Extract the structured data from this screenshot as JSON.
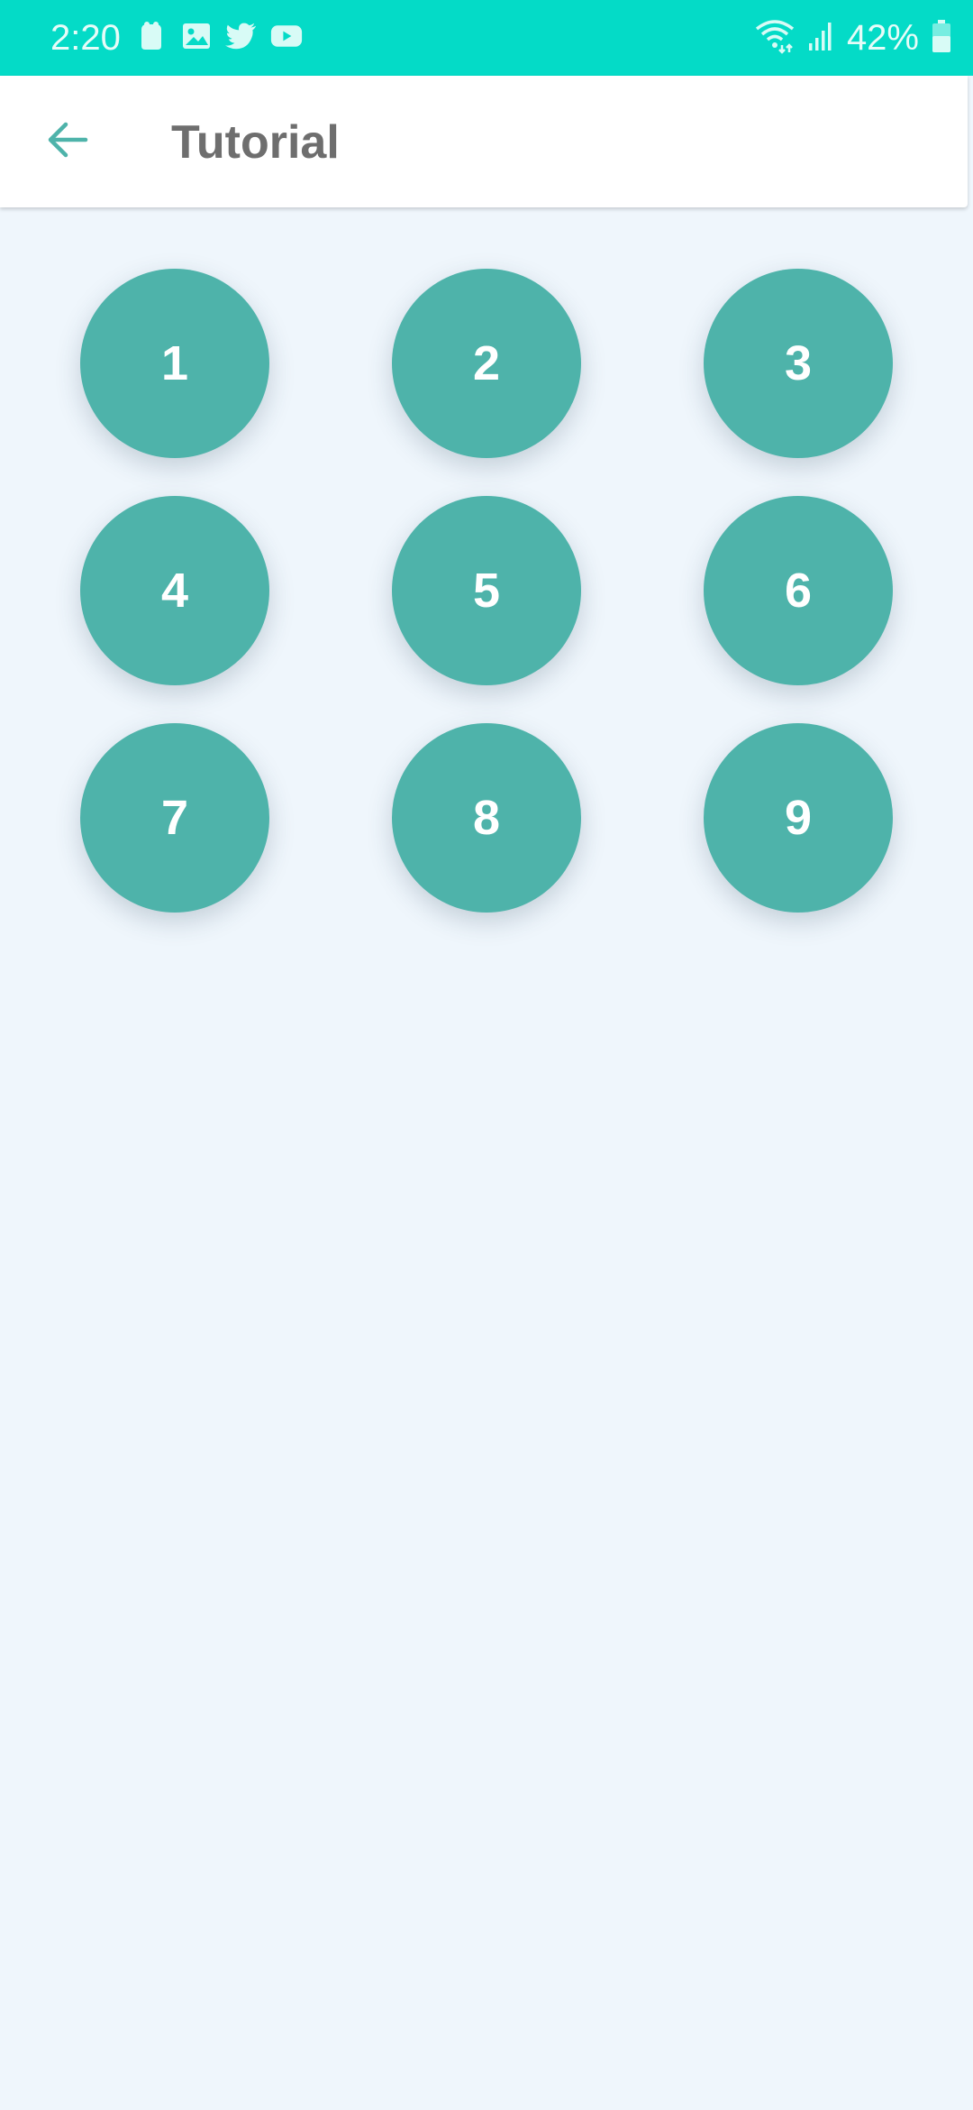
{
  "status_bar": {
    "time": "2:20",
    "battery": "42%",
    "color": "#04DBC7",
    "left_icons": [
      "notification-app-icon",
      "gallery-icon",
      "twitter-icon",
      "youtube-icon"
    ],
    "right_icons": [
      "wifi-icon",
      "signal-icon",
      "battery-icon"
    ]
  },
  "app_bar": {
    "title": "Tutorial",
    "back_icon": "arrow-left-icon"
  },
  "grid": {
    "items": [
      "1",
      "2",
      "3",
      "4",
      "5",
      "6",
      "7",
      "8",
      "9"
    ],
    "accent": "#4EB3AA"
  },
  "background": "#EFF6FC"
}
